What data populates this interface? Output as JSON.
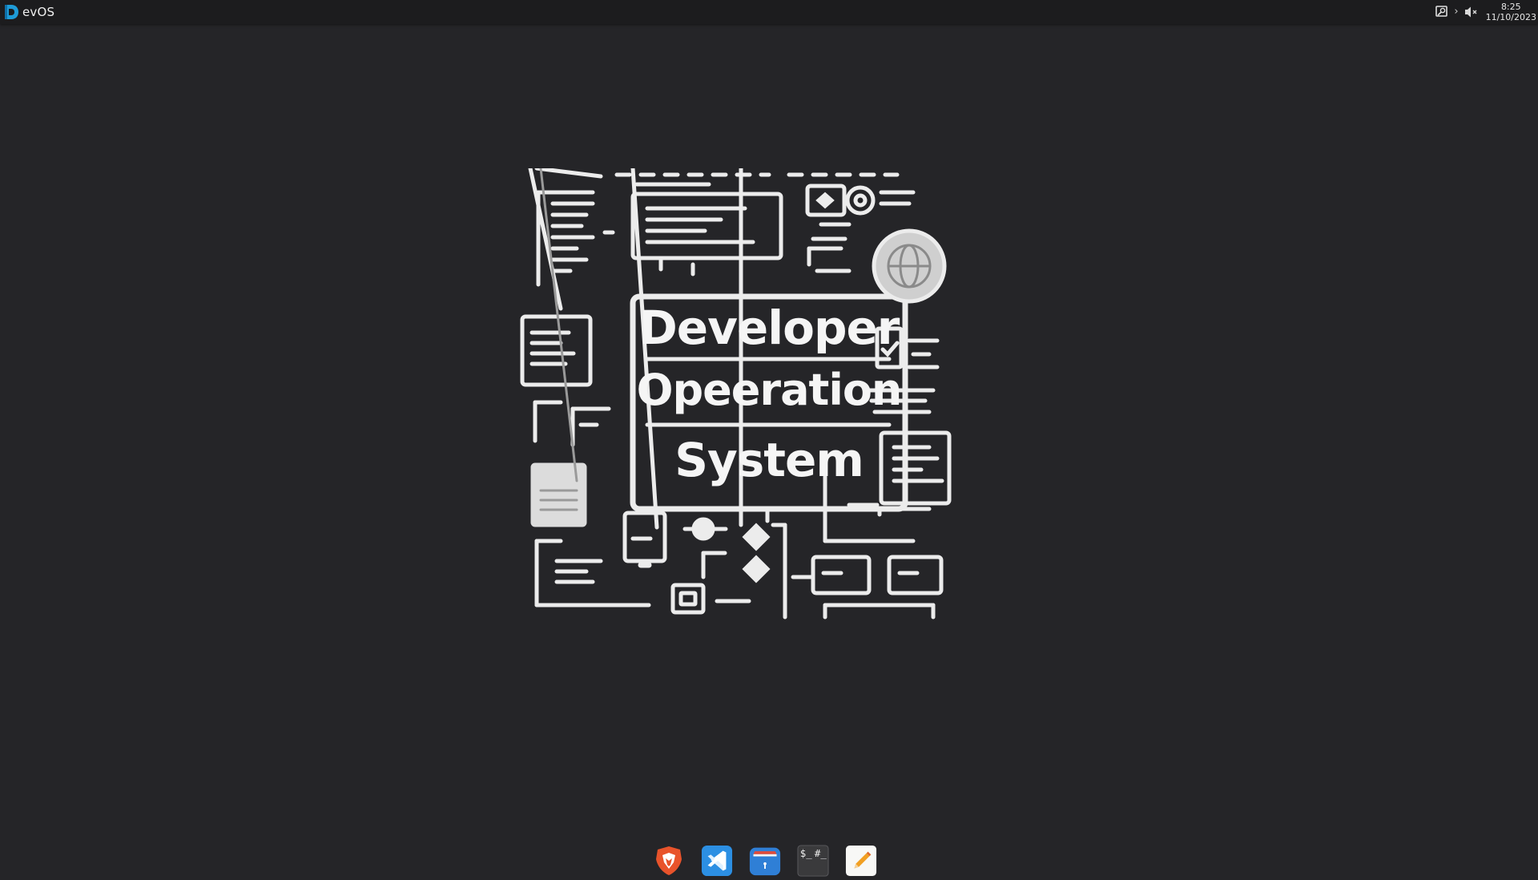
{
  "topbar": {
    "brand_label": "evOS",
    "clock_time": "8:25",
    "clock_date": "11/10/2023",
    "chevron": "›"
  },
  "wallpaper": {
    "title_line1": "Developer",
    "title_line2": "Opeeration",
    "title_line3": "System"
  },
  "dock": {
    "items": [
      {
        "name": "brave-browser",
        "icon": "lion-shield-icon"
      },
      {
        "name": "vs-code",
        "icon": "vscode-icon"
      },
      {
        "name": "app-store",
        "icon": "store-bag-icon"
      },
      {
        "name": "terminal",
        "icon": "terminal-icon",
        "glyph": "$_ #_"
      },
      {
        "name": "text-editor",
        "icon": "pencil-icon"
      }
    ]
  },
  "colors": {
    "background": "#252528",
    "topbar": "#1c1c1e",
    "brand_accent": "#1e9bd7",
    "brave_orange": "#e8532b",
    "vscode_blue": "#2c8fe3",
    "store_blue": "#2f7fd6"
  }
}
